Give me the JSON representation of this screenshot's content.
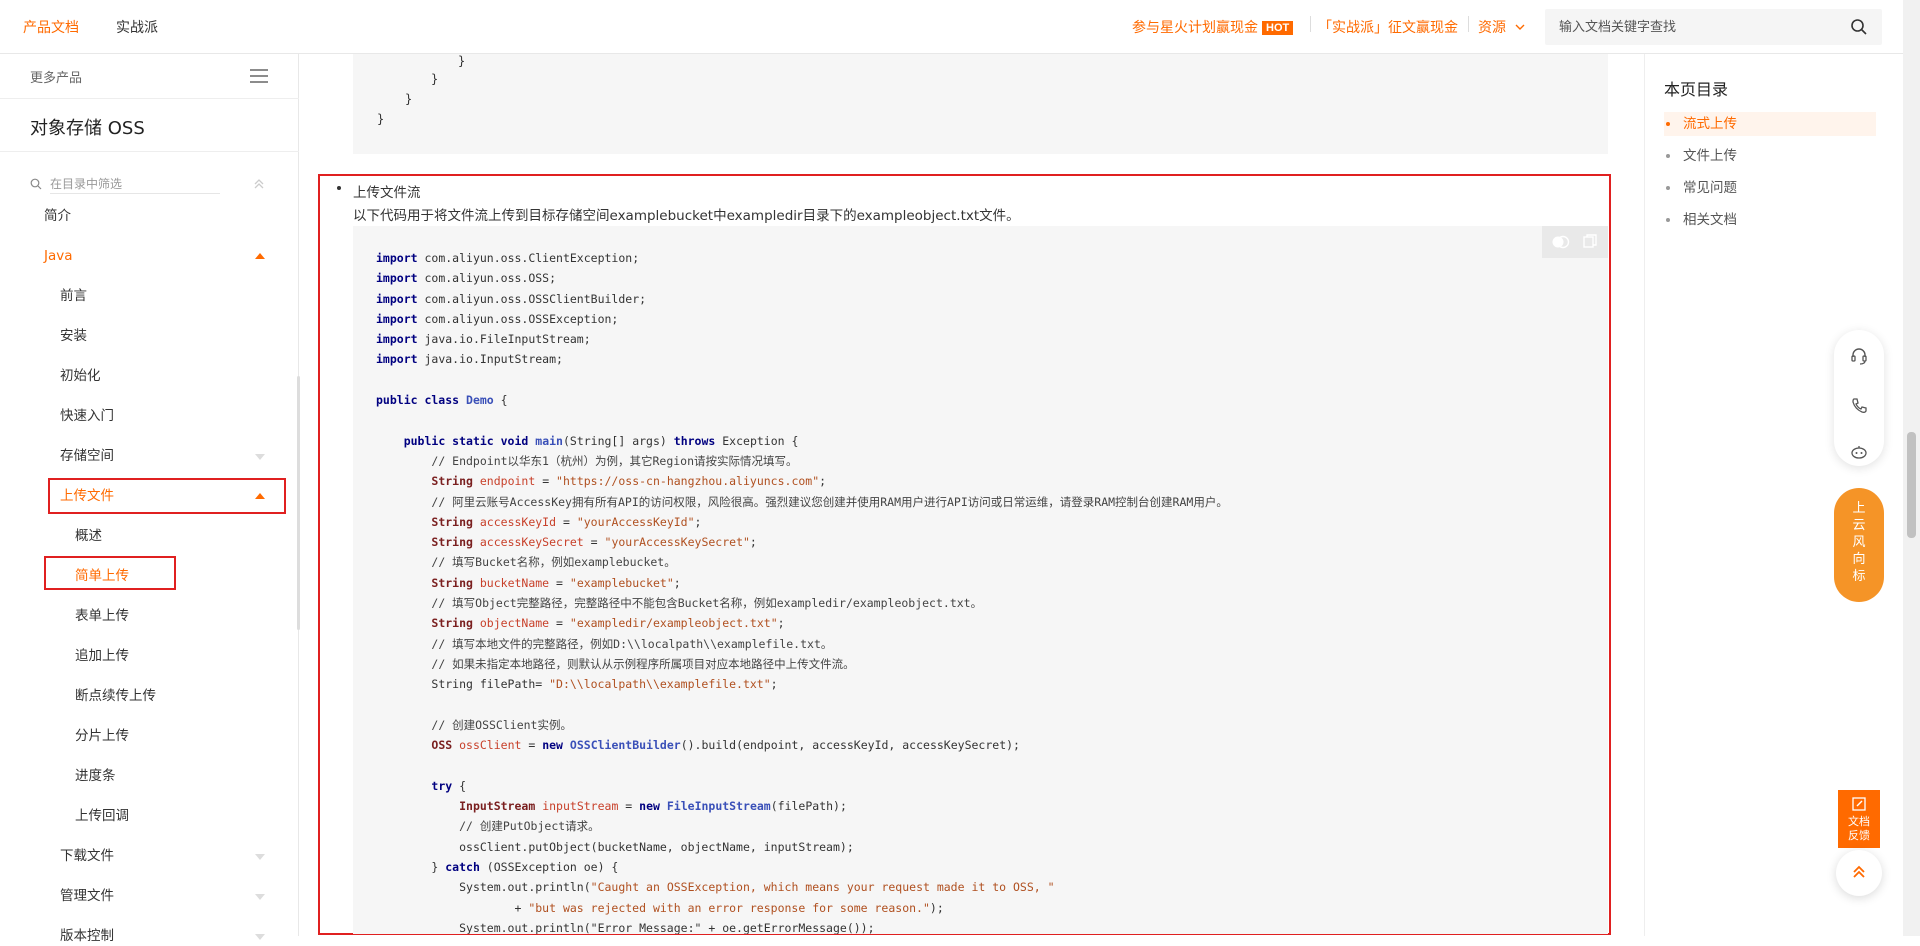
{
  "topbar": {
    "nav": [
      "产品文档",
      "实战派"
    ],
    "promo1": "参与星火计划赢现金",
    "promo1_badge": "HOT",
    "promo2": "「实战派」征文赢现金",
    "resources": "资源",
    "search_placeholder": "输入文档关键字查找"
  },
  "sidebar": {
    "more_products": "更多产品",
    "product_title": "对象存储 OSS",
    "filter_placeholder": "在目录中筛选",
    "items": [
      {
        "label": "简介"
      },
      {
        "label": "Java"
      },
      {
        "label": "前言"
      },
      {
        "label": "安装"
      },
      {
        "label": "初始化"
      },
      {
        "label": "快速入门"
      },
      {
        "label": "存储空间"
      },
      {
        "label": "上传文件"
      },
      {
        "label": "概述"
      },
      {
        "label": "简单上传"
      },
      {
        "label": "表单上传"
      },
      {
        "label": "追加上传"
      },
      {
        "label": "断点续传上传"
      },
      {
        "label": "分片上传"
      },
      {
        "label": "进度条"
      },
      {
        "label": "上传回调"
      },
      {
        "label": "下载文件"
      },
      {
        "label": "管理文件"
      },
      {
        "label": "版本控制"
      }
    ]
  },
  "content": {
    "prev_code_lines": [
      "}",
      "}",
      "}",
      "}"
    ],
    "section_title": "上传文件流",
    "section_desc": "以下代码用于将文件流上传到目标存储空间examplebucket中exampledir目录下的exampleobject.txt文件。",
    "code": {
      "l1": "com.aliyun.oss.ClientException;",
      "l2": "com.aliyun.oss.OSS;",
      "l3": "com.aliyun.oss.OSSClientBuilder;",
      "l4": "com.aliyun.oss.OSSException;",
      "l5": "java.io.FileInputStream;",
      "l6": "java.io.InputStream;",
      "class_name": "Demo",
      "main_sig": "(String[] args)",
      "exception": "Exception {",
      "c_endpoint": "// Endpoint以华东1（杭州）为例，其它Region请按实际情况填写。",
      "endpoint_val": "\"https://oss-cn-hangzhou.aliyuncs.com\"",
      "c_ak": "// 阿里云账号AccessKey拥有所有API的访问权限，风险很高。强烈建议您创建并使用RAM用户进行API访问或日常运维，请登录RAM控制台创建RAM用户。",
      "akid_val": "\"yourAccessKeyId\"",
      "aks_val": "\"yourAccessKeySecret\"",
      "c_bucket": "// 填写Bucket名称，例如examplebucket。",
      "bucket_val": "\"examplebucket\"",
      "c_object": "// 填写Object完整路径，完整路径中不能包含Bucket名称，例如exampledir/exampleobject.txt。",
      "object_val": "\"exampledir/exampleobject.txt\"",
      "c_local": "// 填写本地文件的完整路径，例如D:\\\\localpath\\\\examplefile.txt。",
      "c_local2": "// 如果未指定本地路径，则默认从示例程序所属项目对应本地路径中上传文件流。",
      "filepath_decl": "String filePath= ",
      "filepath_val": "\"D:\\\\localpath\\\\examplefile.txt\"",
      "c_client": "// 创建OSSClient实例。",
      "client_tail": "().build(endpoint, accessKeyId, accessKeySecret);",
      "stream_tail": "(filePath);",
      "c_put": "// 创建PutObject请求。",
      "put_call": "ossClient.putObject(bucketName, objectName, inputStream);",
      "catch_tail": " (OSSException oe) {",
      "println1": "System.out.println(",
      "msg1": "\"Caught an OSSException, which means your request made it to OSS, \"",
      "msg2": "\"but was rejected with an error response for some reason.\"",
      "msg2_tail": ");",
      "println3": "System.out.println(\"Error Message:\" + oe.getErrorMessage());"
    }
  },
  "toc": {
    "title": "本页目录",
    "items": [
      "流式上传",
      "文件上传",
      "常见问题",
      "相关文档"
    ]
  },
  "float": {
    "wind_chars": [
      "上",
      "云",
      "风",
      "向",
      "标"
    ],
    "feedback": [
      "文档",
      "反馈"
    ]
  },
  "colors": {
    "accent": "#ff6a00",
    "highlight": "#e02020"
  }
}
